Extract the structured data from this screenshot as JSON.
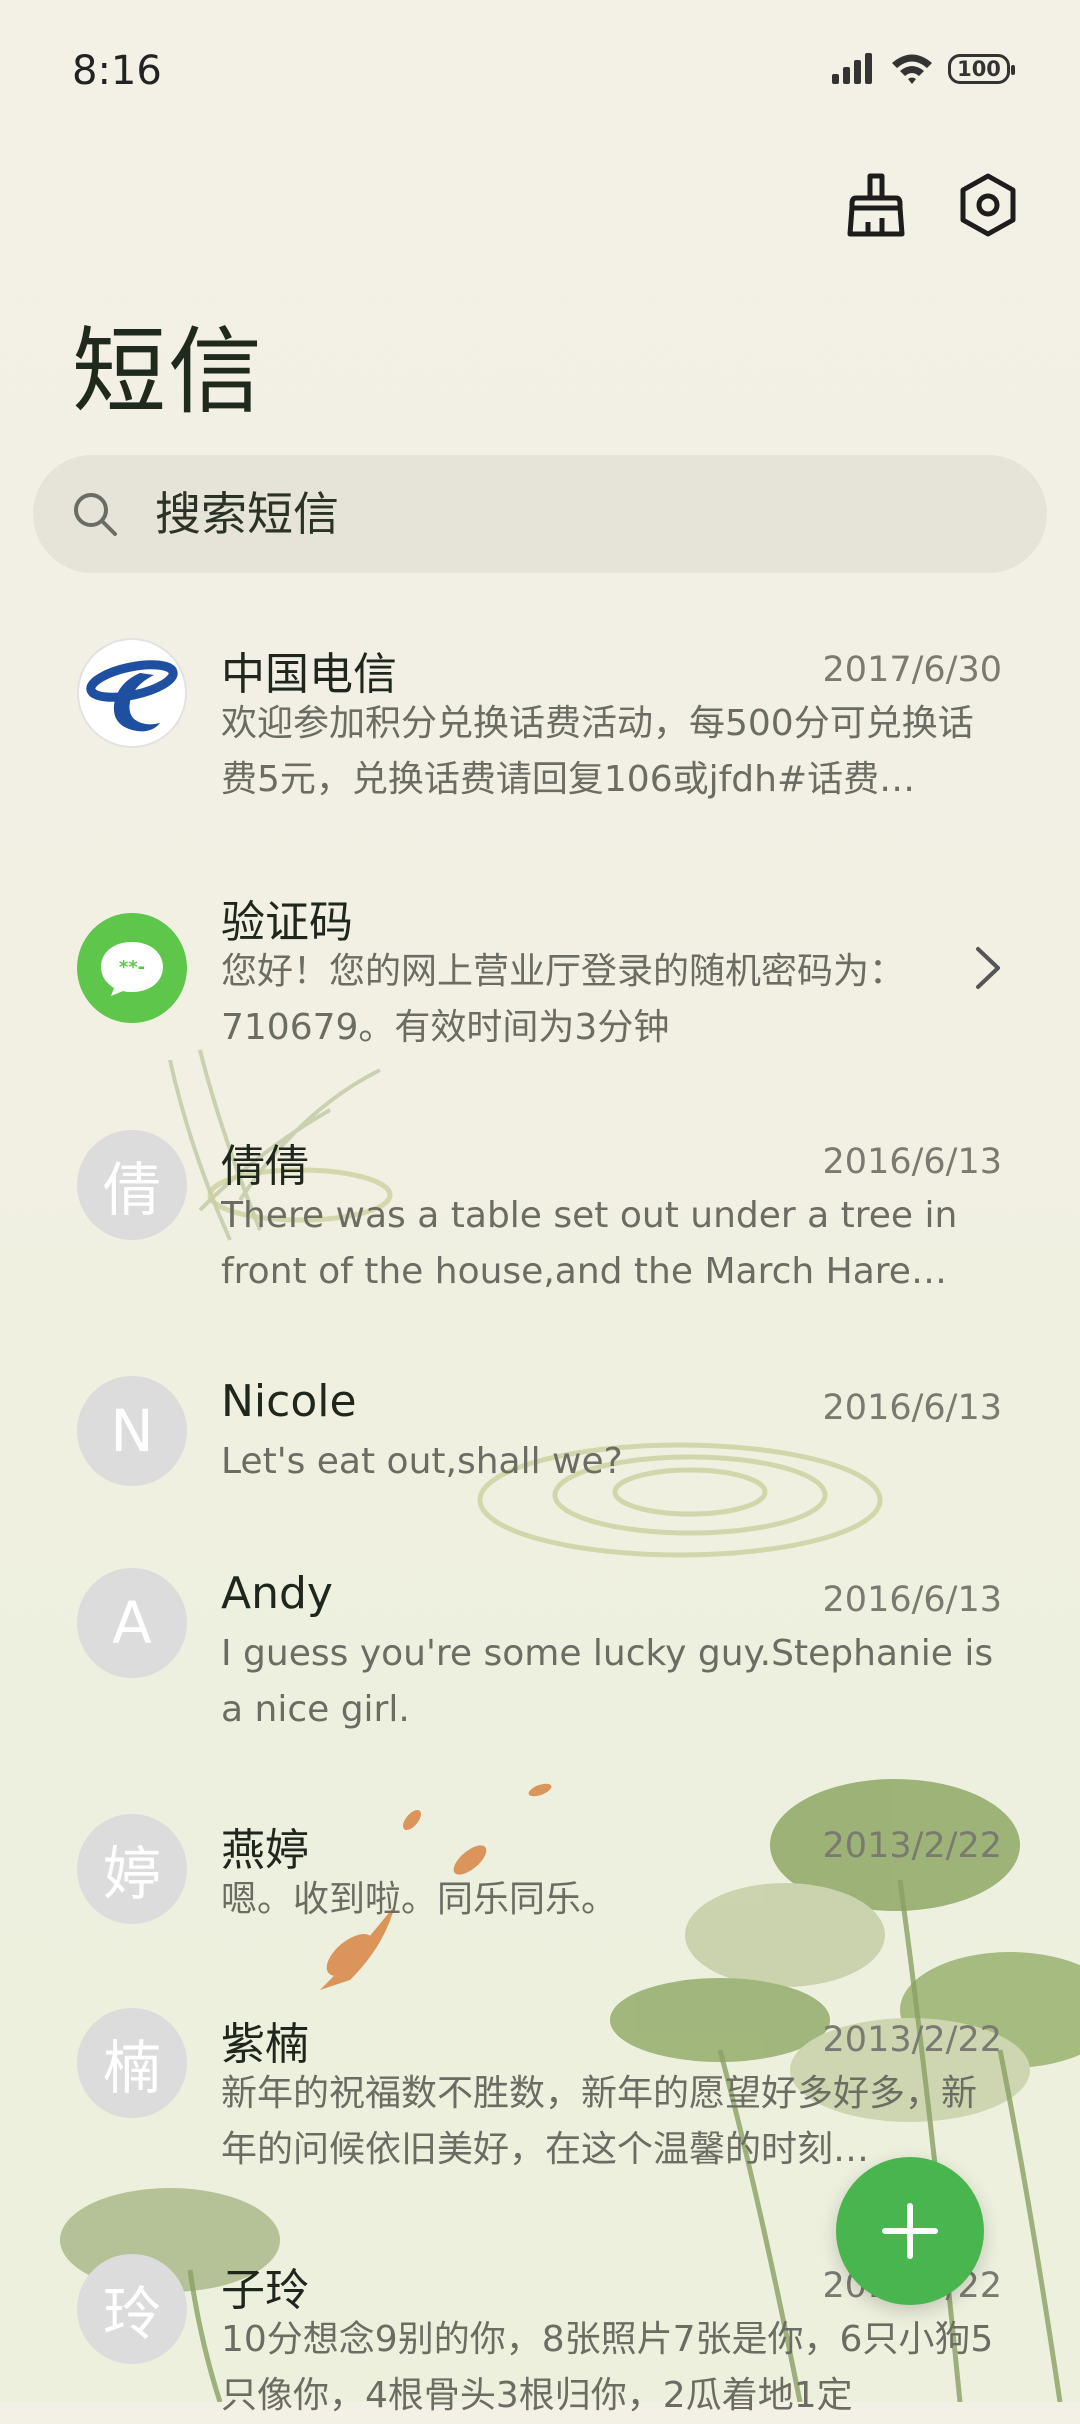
{
  "status": {
    "time": "8:16",
    "battery": "100"
  },
  "header": {
    "title": "短信"
  },
  "search": {
    "placeholder": "搜索短信"
  },
  "conversations": [
    {
      "name": "中国电信",
      "date": "2017/6/30",
      "preview": "欢迎参加积分兑换话费活动，每500分可兑换话费5元，兑换话费请回复106或jfdh#话费…",
      "avatar": ""
    },
    {
      "name": "验证码",
      "date": "",
      "preview": "您好！您的网上营业厅登录的随机密码为：710679。有效时间为3分钟",
      "avatar": "**-"
    },
    {
      "name": "倩倩",
      "date": "2016/6/13",
      "preview": "There was a table set out under a tree in front of the house,and the March Hare an…",
      "avatar": "倩"
    },
    {
      "name": "Nicole",
      "date": "2016/6/13",
      "preview": "Let's eat out,shall we?",
      "avatar": "N"
    },
    {
      "name": "Andy",
      "date": "2016/6/13",
      "preview": "I guess you're some lucky guy.Stephanie is a nice girl.",
      "avatar": "A"
    },
    {
      "name": "燕婷",
      "date": "2013/2/22",
      "preview": "嗯。收到啦。同乐同乐。",
      "avatar": "婷"
    },
    {
      "name": "紫楠",
      "date": "2013/2/22",
      "preview": "新年的祝福数不胜数，新年的愿望好多好多，新年的问候依旧美好，在这个温馨的时刻…",
      "avatar": "楠"
    },
    {
      "name": "子玲",
      "date": "2013/2/22",
      "preview": "10分想念9别的你，8张照片7张是你，6只小狗5只像你，4根骨头3根归你，2瓜着地1定",
      "avatar": "玲"
    }
  ],
  "icons": {
    "clean": "broom-icon",
    "settings": "gear-icon",
    "search": "search-icon",
    "new_message": "plus-icon"
  },
  "colors": {
    "accent": "#49b54e",
    "verification": "#5ec64a",
    "carrier_blue": "#1f4fa0"
  }
}
